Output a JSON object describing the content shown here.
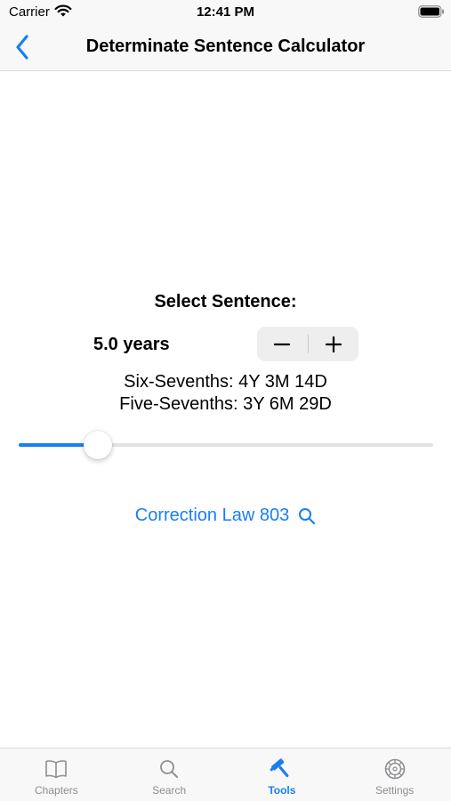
{
  "status_bar": {
    "carrier": "Carrier",
    "time": "12:41 PM"
  },
  "nav": {
    "title": "Determinate Sentence Calculator",
    "back_icon": "chevron-left-icon"
  },
  "calculator": {
    "select_label": "Select Sentence:",
    "years_value": "5.0 years",
    "stepper": {
      "decrement_symbol": "−",
      "increment_symbol": "+"
    },
    "six_sevenths": "Six-Sevenths: 4Y 3M 14D",
    "five_sevenths": "Five-Sevenths: 3Y 6M 29D",
    "slider_fraction": 0.19
  },
  "law_link": {
    "label": "Correction Law 803",
    "icon": "search-icon"
  },
  "tabs": [
    {
      "label": "Chapters",
      "icon": "book-icon",
      "active": false
    },
    {
      "label": "Search",
      "icon": "search-icon",
      "active": false
    },
    {
      "label": "Tools",
      "icon": "hammer-icon",
      "active": true
    },
    {
      "label": "Settings",
      "icon": "gear-icon",
      "active": false
    }
  ],
  "colors": {
    "accent": "#1a7ef0",
    "inactive": "#8e8e93",
    "bar_background": "#f8f8f8"
  }
}
